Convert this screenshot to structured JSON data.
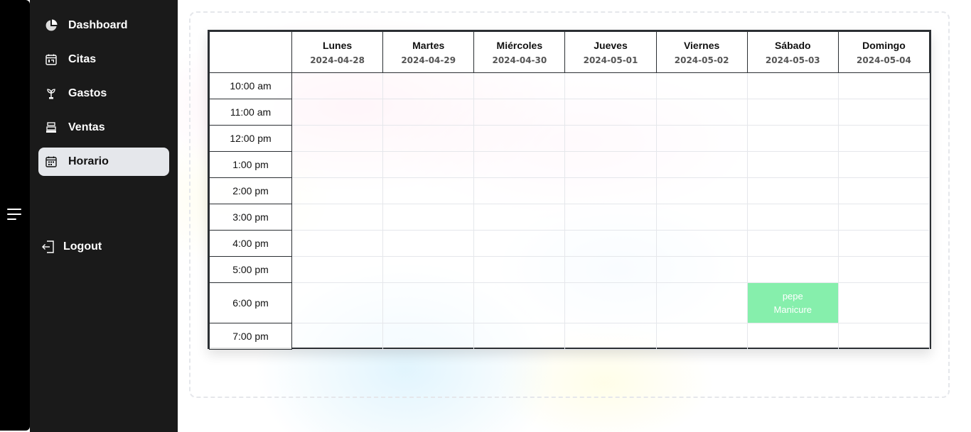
{
  "sidebar": {
    "items": [
      {
        "label": "Dashboard",
        "icon": "pie-chart-icon",
        "active": false
      },
      {
        "label": "Citas",
        "icon": "calendar-icon",
        "active": false
      },
      {
        "label": "Gastos",
        "icon": "money-plant-icon",
        "active": false
      },
      {
        "label": "Ventas",
        "icon": "cash-register-icon",
        "active": false
      },
      {
        "label": "Horario",
        "icon": "schedule-icon",
        "active": true
      }
    ],
    "logout_label": "Logout"
  },
  "schedule": {
    "days": [
      {
        "name": "Lunes",
        "date": "2024-04-28"
      },
      {
        "name": "Martes",
        "date": "2024-04-29"
      },
      {
        "name": "Miércoles",
        "date": "2024-04-30"
      },
      {
        "name": "Jueves",
        "date": "2024-05-01"
      },
      {
        "name": "Viernes",
        "date": "2024-05-02"
      },
      {
        "name": "Sábado",
        "date": "2024-05-03"
      },
      {
        "name": "Domingo",
        "date": "2024-05-04"
      }
    ],
    "times": [
      "10:00 am",
      "11:00 am",
      "12:00 pm",
      "1:00 pm",
      "2:00 pm",
      "3:00 pm",
      "4:00 pm",
      "5:00 pm",
      "6:00 pm",
      "7:00 pm"
    ],
    "appointments": [
      {
        "time": "6:00 pm",
        "day": "Sábado",
        "client": "pepe",
        "service": "Manicure",
        "color": "#86efac"
      }
    ]
  },
  "colors": {
    "sidebar_bg": "#1a1a1a",
    "rail_bg": "#000000",
    "active_item_bg": "#e5e7eb",
    "appointment": "#86efac"
  }
}
